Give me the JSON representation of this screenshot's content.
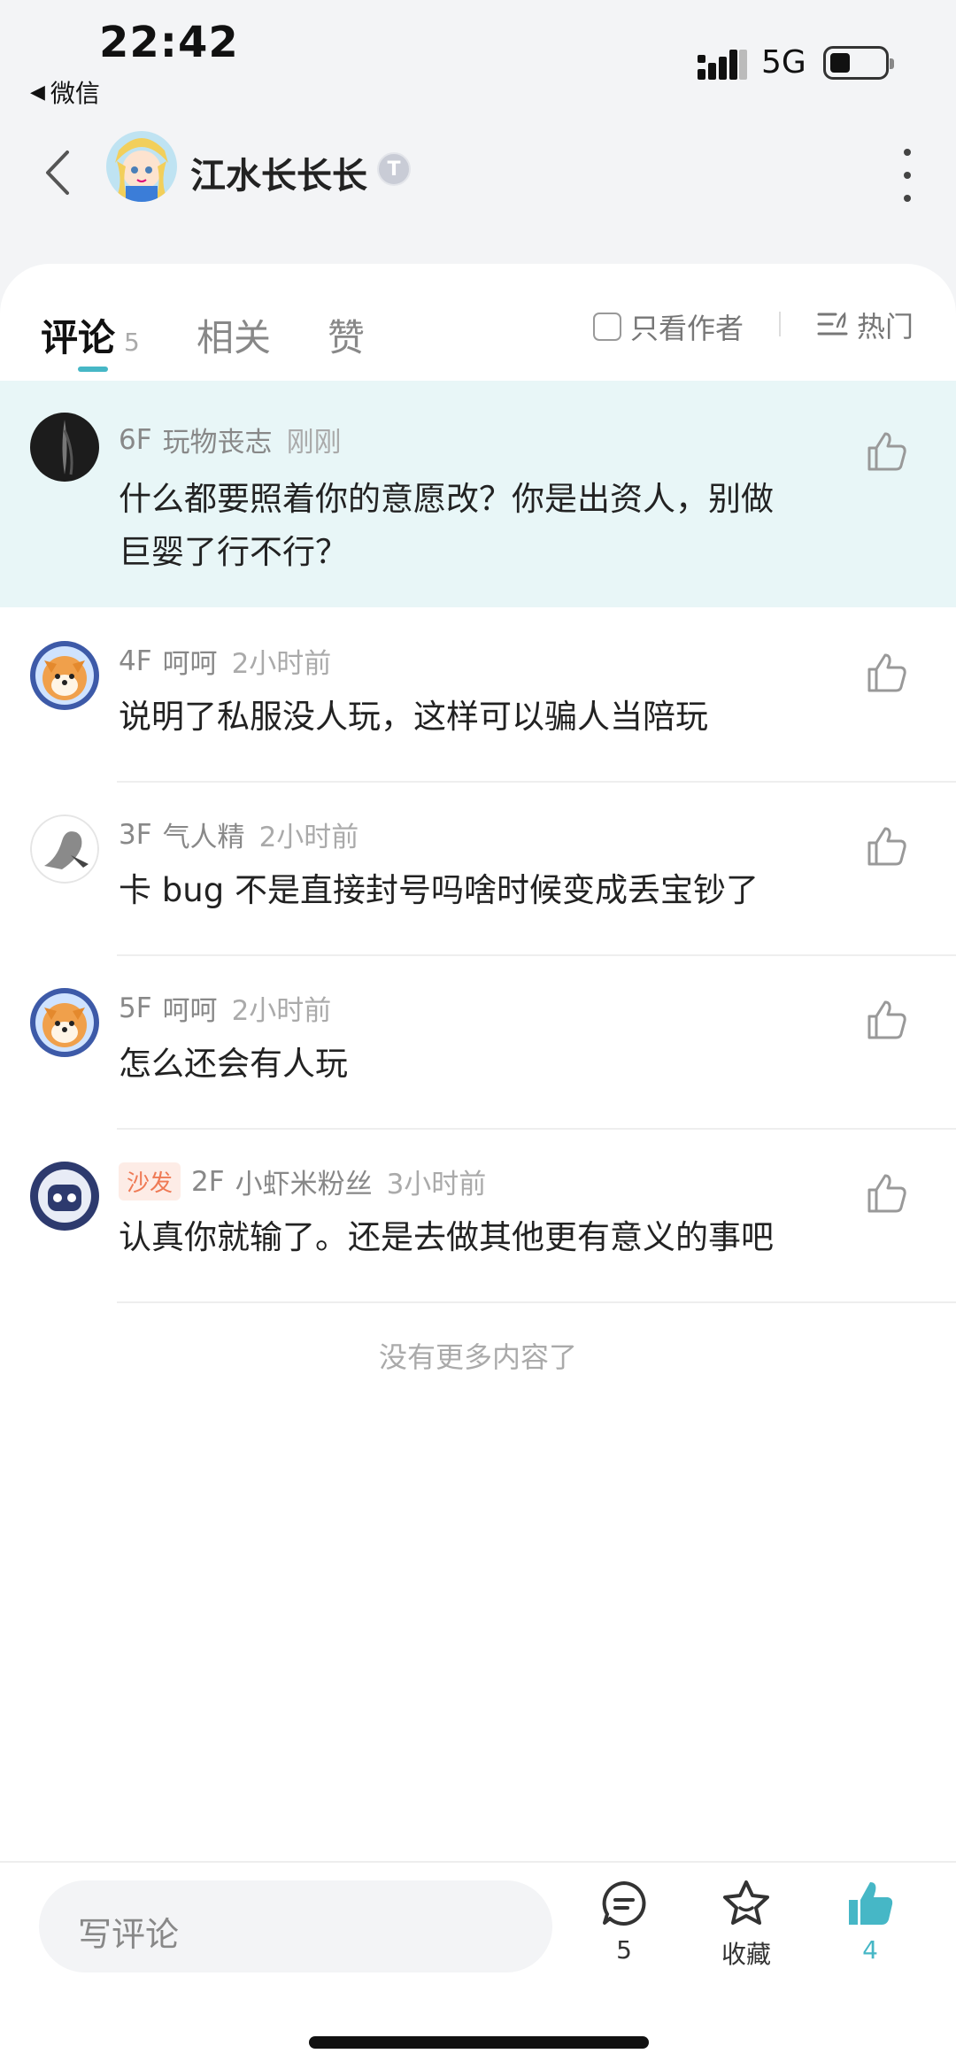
{
  "status_bar": {
    "time": "22:42",
    "back_app": "微信",
    "network": "5G"
  },
  "header": {
    "username": "江水长长长",
    "badge": "T"
  },
  "tabs": {
    "comments_label": "评论",
    "comments_count": "5",
    "related_label": "相关",
    "likes_label": "赞",
    "author_only_label": "只看作者",
    "sort_label": "热门"
  },
  "comments": [
    {
      "floor": "6F",
      "user": "玩物丧志",
      "time": "刚刚",
      "text_line1": "什么都要照着你的意愿改？你是出资人，别做",
      "text_line2": "巨婴了行不行？",
      "highlighted": true
    },
    {
      "floor": "4F",
      "user": "呵呵",
      "time": "2小时前",
      "text_line1": "说明了私服没人玩，这样可以骗人当陪玩"
    },
    {
      "floor": "3F",
      "user": "气人精",
      "time": "2小时前",
      "text_line1": "卡 bug 不是直接封号吗啥时候变成丢宝钞了"
    },
    {
      "floor": "5F",
      "user": "呵呵",
      "time": "2小时前",
      "text_line1": "怎么还会有人玩"
    },
    {
      "tag": "沙发",
      "floor": "2F",
      "user": "小虾米粉丝",
      "time": "3小时前",
      "text_line1": "认真你就输了。还是去做其他更有意义的事吧"
    }
  ],
  "footer_note": "没有更多内容了",
  "bottom_bar": {
    "write_placeholder": "写评论",
    "comment_count": "5",
    "favorite_label": "收藏",
    "like_count": "4"
  },
  "colors": {
    "accent": "#46b7c6",
    "highlight_bg": "#e8f6f7",
    "sofa_tag": "#ef7a55"
  }
}
